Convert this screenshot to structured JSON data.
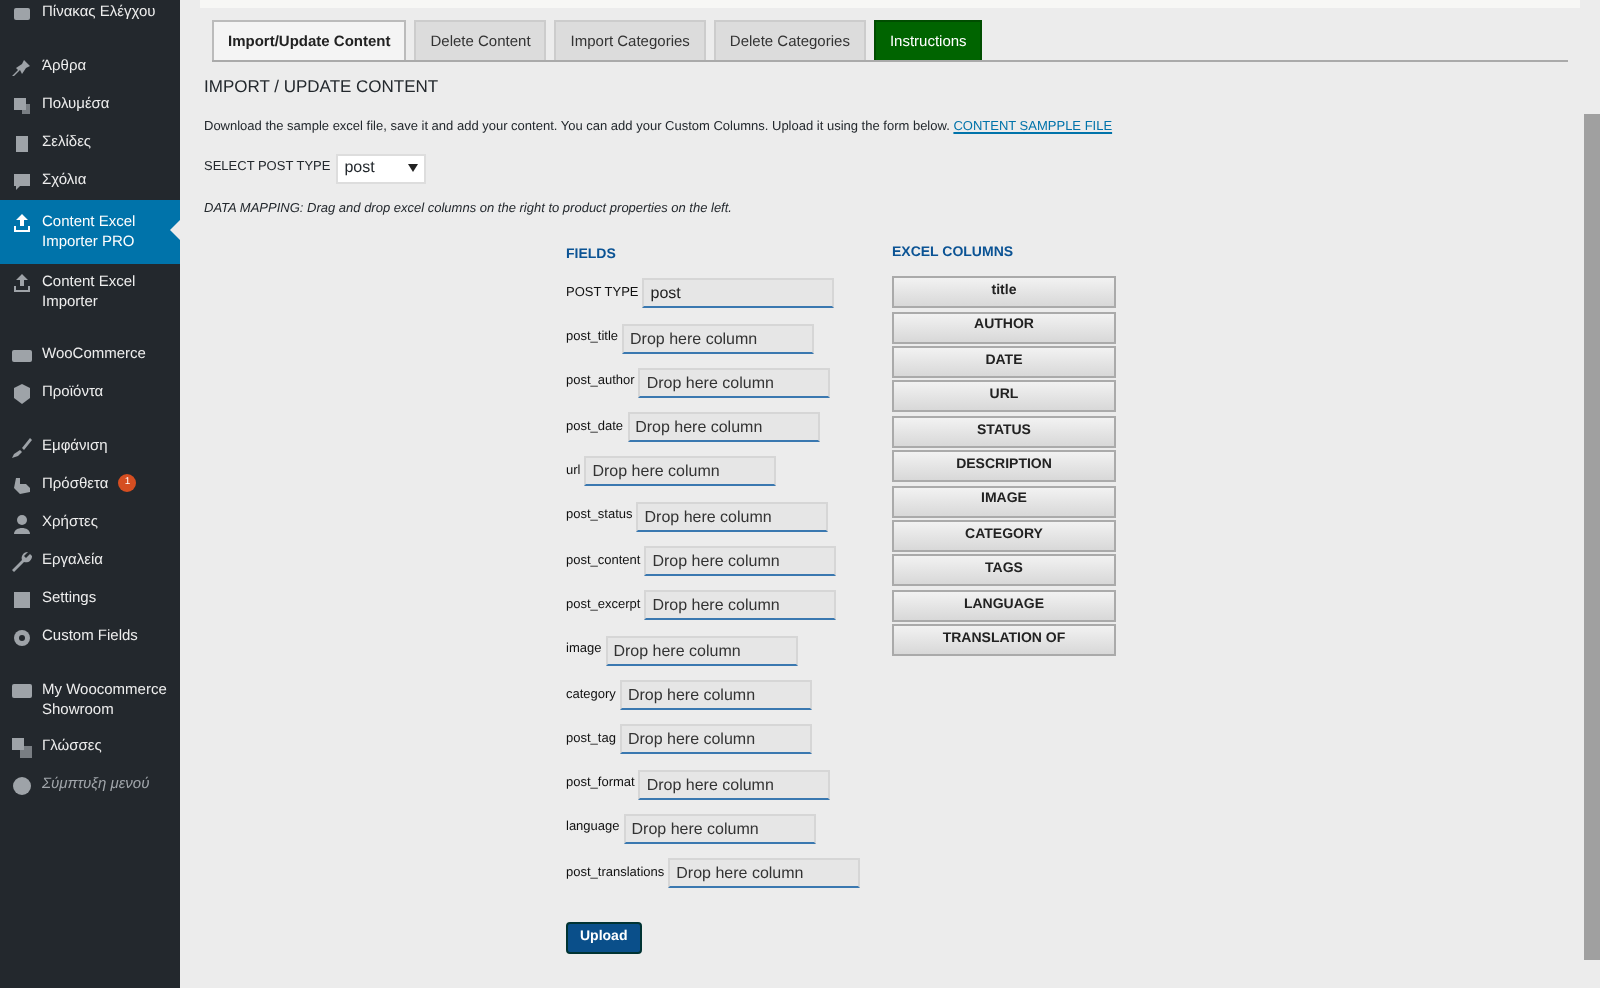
{
  "sidebar": {
    "groups": [
      {
        "items": [
          {
            "label": "Πίνακας Ελέγχου",
            "selected": false,
            "kind": "link"
          }
        ]
      },
      {
        "items": [
          {
            "label": "Άρθρα",
            "selected": false,
            "kind": "link"
          },
          {
            "label": "Πολυμέσα",
            "selected": false,
            "kind": "link"
          },
          {
            "label": "Σελίδες",
            "selected": false,
            "kind": "link"
          },
          {
            "label": "Σχόλια",
            "selected": false,
            "kind": "link"
          },
          {
            "label": "Content Excel Importer PRO",
            "selected": true,
            "kind": "link"
          },
          {
            "label": "Content Excel Importer",
            "selected": false,
            "kind": "link"
          }
        ]
      },
      {
        "items": [
          {
            "label": "WooCommerce",
            "selected": false,
            "kind": "link"
          },
          {
            "label": "Προϊόντα",
            "selected": false,
            "kind": "link"
          }
        ]
      },
      {
        "items": [
          {
            "label": "Εμφάνιση",
            "selected": false,
            "kind": "link"
          },
          {
            "label": "Πρόσθετα",
            "selected": false,
            "kind": "link",
            "badge": "1"
          },
          {
            "label": "Χρήστες",
            "selected": false,
            "kind": "link"
          },
          {
            "label": "Εργαλεία",
            "selected": false,
            "kind": "link"
          },
          {
            "label": "Settings",
            "selected": false,
            "kind": "link"
          },
          {
            "label": "Custom Fields",
            "selected": false,
            "kind": "link"
          }
        ]
      },
      {
        "items": [
          {
            "label": "My Woocommerce Showroom",
            "selected": false,
            "kind": "link"
          },
          {
            "label": "Γλώσσες",
            "selected": false,
            "kind": "link"
          },
          {
            "label": "Σύμπτυξη μενού",
            "selected": false,
            "kind": "collapse"
          }
        ]
      }
    ]
  },
  "tabs": [
    {
      "label": "Import/Update Content",
      "selected": true,
      "kind": "normal"
    },
    {
      "label": "Delete Content",
      "selected": false,
      "kind": "normal"
    },
    {
      "label": "Import Categories",
      "selected": false,
      "kind": "normal"
    },
    {
      "label": "Delete Categories",
      "selected": false,
      "kind": "normal"
    },
    {
      "label": "Instructions",
      "selected": false,
      "kind": "highlight"
    }
  ],
  "heading": "IMPORT / UPDATE CONTENT",
  "intro": "Download the sample excel file, save it and add your content. You can add your Custom Columns. Upload it using the form below.",
  "sample_link": "CONTENT SAMPPLE FILE",
  "post_type_select": {
    "label": "SELECT POST TYPE",
    "value": "post"
  },
  "mapping_note": "DATA MAPPING: Drag and drop excel columns on the right to product properties on the left.",
  "fields": {
    "title": "FIELDS",
    "rows": [
      {
        "label": "POST TYPE",
        "value": "post"
      },
      {
        "label": "post_title",
        "placeholder": "Drop here column"
      },
      {
        "label": "post_author",
        "placeholder": "Drop here column"
      },
      {
        "label": "post_date",
        "placeholder": "Drop here column"
      },
      {
        "label": "url",
        "placeholder": "Drop here column"
      },
      {
        "label": "post_status",
        "placeholder": "Drop here column"
      },
      {
        "label": "post_content",
        "placeholder": "Drop here column"
      },
      {
        "label": "post_excerpt",
        "placeholder": "Drop here column"
      },
      {
        "label": "image",
        "placeholder": "Drop here column"
      },
      {
        "label": "category",
        "placeholder": "Drop here column"
      },
      {
        "label": "post_tag",
        "placeholder": "Drop here column"
      },
      {
        "label": "post_format",
        "placeholder": "Drop here column"
      },
      {
        "label": "language",
        "placeholder": "Drop here column"
      },
      {
        "label": "post_translations",
        "placeholder": "Drop here column"
      }
    ]
  },
  "excel_columns": {
    "title": "EXCEL COLUMNS",
    "items": [
      "title",
      "AUTHOR",
      "DATE",
      "URL",
      "STATUS",
      "DESCRIPTION",
      "IMAGE",
      "CATEGORY",
      "TAGS",
      "LANGUAGE",
      "TRANSLATION OF"
    ]
  },
  "upload_button": "Upload"
}
